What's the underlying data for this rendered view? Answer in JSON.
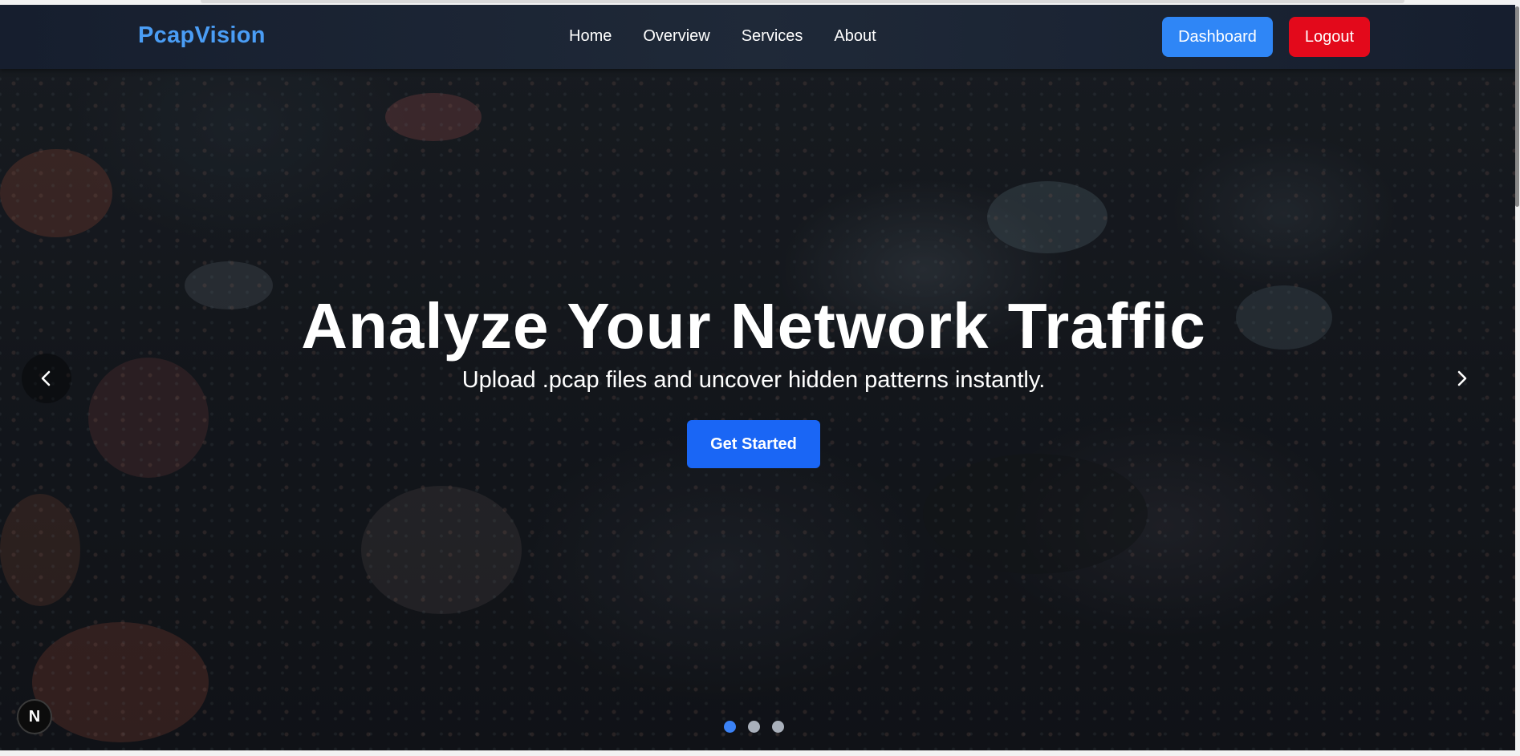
{
  "navbar": {
    "brand": "PcapVision",
    "links": [
      "Home",
      "Overview",
      "Services",
      "About"
    ],
    "dashboard_label": "Dashboard",
    "logout_label": "Logout"
  },
  "hero": {
    "title": "Analyze Your Network Traffic",
    "subtitle": "Upload .pcap files and uncover hidden patterns instantly.",
    "cta_label": "Get Started"
  },
  "carousel": {
    "slide_count": 3,
    "active_index": 0
  },
  "badge": {
    "letter": "N"
  },
  "colors": {
    "brand": "#4a9df5",
    "dashboard_button": "#2f86f6",
    "logout_button": "#e3091b",
    "cta_button": "#1a66f5",
    "active_dot": "#3b82f6",
    "inactive_dot": "#a9b0bb"
  },
  "icons": {
    "prev": "chevron-left-icon",
    "next": "chevron-right-icon"
  }
}
